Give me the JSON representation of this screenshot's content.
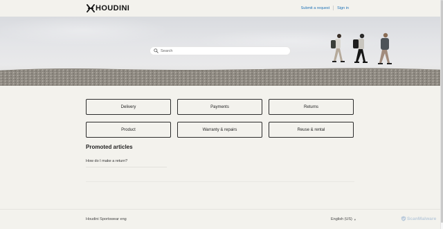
{
  "header": {
    "logo_text": "HOUDINI",
    "logo_icon": "houdini-logo-icon",
    "submit_request": "Submit a request",
    "sign_in": "Sign in"
  },
  "hero": {
    "search_placeholder": "Search",
    "search_icon": "search-icon"
  },
  "categories": [
    {
      "label": "Delivery"
    },
    {
      "label": "Payments"
    },
    {
      "label": "Returns"
    },
    {
      "label": "Product"
    },
    {
      "label": "Warranty & repairs"
    },
    {
      "label": "Reuse & rental"
    }
  ],
  "promoted": {
    "title": "Promoted articles",
    "articles": [
      {
        "title": "How do I make a return?"
      }
    ]
  },
  "footer": {
    "brand": "Houdini Sportswear eng",
    "language": "English (US)",
    "language_icon": "chevron-down-icon"
  },
  "watermark": {
    "text": "ScanMalware"
  },
  "colors": {
    "background": "#f3f2ed",
    "link": "#1f73b7",
    "border": "#2b2b2b"
  }
}
